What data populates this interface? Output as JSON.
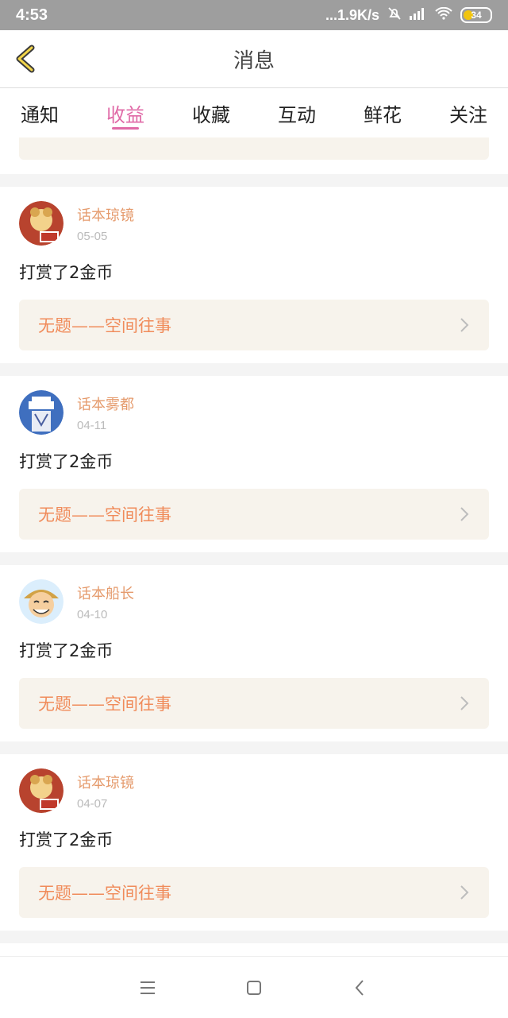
{
  "status": {
    "time": "4:53",
    "network": "...1.9K/s",
    "battery": "34"
  },
  "header": {
    "title": "消息"
  },
  "tabs": [
    {
      "label": "通知"
    },
    {
      "label": "收益",
      "active": true
    },
    {
      "label": "收藏"
    },
    {
      "label": "互动"
    },
    {
      "label": "鲜花"
    },
    {
      "label": "关注"
    }
  ],
  "entries": [
    {
      "name": "话本琼镜",
      "date": "05-05",
      "action": "打赏了2金币",
      "link": "无题——空间往事",
      "avatar": "bear-avatar"
    },
    {
      "name": "话本雾都",
      "date": "04-11",
      "action": "打赏了2金币",
      "link": "无题——空间往事",
      "avatar": "kid-avatar"
    },
    {
      "name": "话本船长",
      "date": "04-10",
      "action": "打赏了2金币",
      "link": "无题——空间往事",
      "avatar": "luffy-avatar"
    },
    {
      "name": "话本琼镜",
      "date": "04-07",
      "action": "打赏了2金币",
      "link": "无题——空间往事",
      "avatar": "bear-avatar"
    }
  ],
  "colors": {
    "accent": "#e06aa7",
    "name": "#e59b6d",
    "link": "#f08b5a",
    "statusbar": "#9e9e9e"
  }
}
